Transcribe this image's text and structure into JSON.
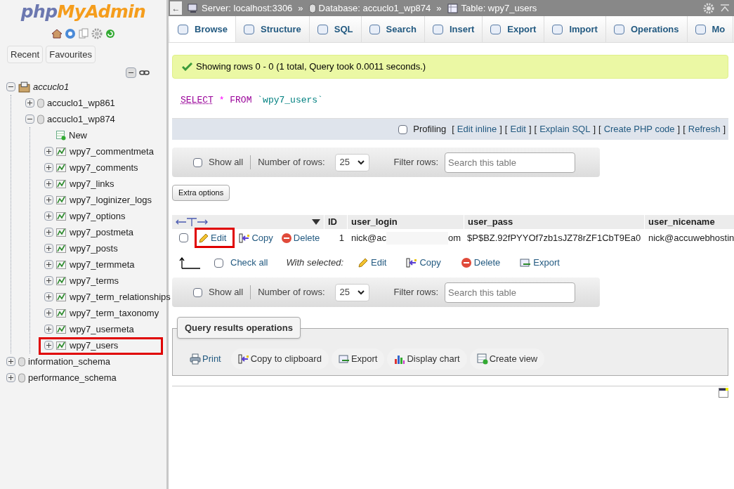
{
  "sidebar": {
    "logo_left": "php",
    "logo_right": "MyAdmin",
    "buttons": [
      {
        "label": "Recent"
      },
      {
        "label": "Favourites"
      }
    ],
    "tree": [
      {
        "label": "accuclo1",
        "kind": "server",
        "expanded": true,
        "highlighted": false,
        "children": [
          {
            "label": "accuclo1_wp861",
            "kind": "database",
            "expanded": false,
            "highlighted": false
          },
          {
            "label": "accuclo1_wp874",
            "kind": "database",
            "expanded": true,
            "highlighted": false,
            "children": [
              {
                "label": "New",
                "kind": "new",
                "highlighted": false
              },
              {
                "label": "wpy7_commentmeta",
                "kind": "table",
                "expanded": false,
                "highlighted": false
              },
              {
                "label": "wpy7_comments",
                "kind": "table",
                "expanded": false,
                "highlighted": false
              },
              {
                "label": "wpy7_links",
                "kind": "table",
                "expanded": false,
                "highlighted": false
              },
              {
                "label": "wpy7_loginizer_logs",
                "kind": "table",
                "expanded": false,
                "highlighted": false
              },
              {
                "label": "wpy7_options",
                "kind": "table",
                "expanded": false,
                "highlighted": false
              },
              {
                "label": "wpy7_postmeta",
                "kind": "table",
                "expanded": false,
                "highlighted": false
              },
              {
                "label": "wpy7_posts",
                "kind": "table",
                "expanded": false,
                "highlighted": false
              },
              {
                "label": "wpy7_termmeta",
                "kind": "table",
                "expanded": false,
                "highlighted": false
              },
              {
                "label": "wpy7_terms",
                "kind": "table",
                "expanded": false,
                "highlighted": false
              },
              {
                "label": "wpy7_term_relationships",
                "kind": "table",
                "expanded": false,
                "highlighted": false
              },
              {
                "label": "wpy7_term_taxonomy",
                "kind": "table",
                "expanded": false,
                "highlighted": false
              },
              {
                "label": "wpy7_usermeta",
                "kind": "table",
                "expanded": false,
                "highlighted": false
              },
              {
                "label": "wpy7_users",
                "kind": "table",
                "expanded": false,
                "highlighted": true
              }
            ]
          }
        ]
      },
      {
        "label": "information_schema",
        "kind": "database",
        "expanded": false,
        "highlighted": false
      },
      {
        "label": "performance_schema",
        "kind": "database",
        "expanded": false,
        "highlighted": false
      }
    ]
  },
  "breadcrumb": [
    {
      "label": "Server: localhost:3306",
      "kind": "server"
    },
    {
      "label": "Database: accuclo1_wp874",
      "kind": "database"
    },
    {
      "label": "Table: wpy7_users",
      "kind": "table"
    }
  ],
  "breadcrumb_separator": "»",
  "back": "←",
  "tabs": [
    {
      "label": "Browse",
      "selected": true
    },
    {
      "label": "Structure",
      "selected": false
    },
    {
      "label": "SQL",
      "selected": false
    },
    {
      "label": "Search",
      "selected": false
    },
    {
      "label": "Insert",
      "selected": false
    },
    {
      "label": "Export",
      "selected": false
    },
    {
      "label": "Import",
      "selected": false
    },
    {
      "label": "Operations",
      "selected": false
    },
    {
      "label": "Mo",
      "selected": false
    }
  ],
  "message": "Showing rows 0 - 0 (1 total, Query took 0.0011 seconds.)",
  "query": {
    "keyword1": "SELECT",
    "star": "*",
    "keyword2": "FROM",
    "table": "`wpy7_users`"
  },
  "query_links": {
    "profiling": "Profiling",
    "profiling_checked": false,
    "links": [
      {
        "open": "[",
        "label": "Edit inline",
        "close": "]"
      },
      {
        "open": "[",
        "label": "Edit",
        "close": "]"
      },
      {
        "open": "[",
        "label": "Explain SQL",
        "close": "]"
      },
      {
        "open": "[",
        "label": "Create PHP code",
        "close": "]"
      },
      {
        "open": "[",
        "label": "Refresh",
        "close": "]"
      }
    ]
  },
  "navigation": [
    {
      "show_all": "Show all",
      "show_all_checked": false,
      "rows_label": "Number of rows:",
      "rows": "25",
      "filter_label": "Filter rows:",
      "filter_placeholder": "Search this table"
    },
    {
      "show_all": "Show all",
      "show_all_checked": false,
      "rows_label": "Number of rows:",
      "rows": "25",
      "filter_label": "Filter rows:",
      "filter_placeholder": "Search this table"
    }
  ],
  "extra_options": "Extra options",
  "table": {
    "columns": [
      "ID",
      "user_login",
      "user_pass",
      "user_nicename"
    ],
    "rows": [
      {
        "checked": false,
        "actions": [
          {
            "label": "Edit",
            "kind": "edit",
            "highlighted": true
          },
          {
            "label": "Copy",
            "kind": "copy",
            "highlighted": false
          },
          {
            "label": "Delete",
            "kind": "delete",
            "highlighted": false
          }
        ],
        "id": "1",
        "login_start": "nick@ac",
        "login_end": "om",
        "pass": "$P$BZ.92fPYYOf7zb1sJZ78rZF1CbT9Ea0",
        "nicename": "nick@accuwebhostin"
      }
    ]
  },
  "bulk": {
    "check_all": "Check all",
    "check_all_checked": false,
    "with_selected": "With selected:",
    "actions": [
      {
        "label": "Edit",
        "kind": "edit"
      },
      {
        "label": "Copy",
        "kind": "copy"
      },
      {
        "label": "Delete",
        "kind": "delete"
      },
      {
        "label": "Export",
        "kind": "export"
      }
    ]
  },
  "operations": {
    "title": "Query results operations",
    "actions": [
      {
        "label": "Print",
        "kind": "print"
      },
      {
        "label": "Copy to clipboard",
        "kind": "copy"
      },
      {
        "label": "Export",
        "kind": "export"
      },
      {
        "label": "Display chart",
        "kind": "chart"
      },
      {
        "label": "Create view",
        "kind": "view"
      }
    ]
  }
}
